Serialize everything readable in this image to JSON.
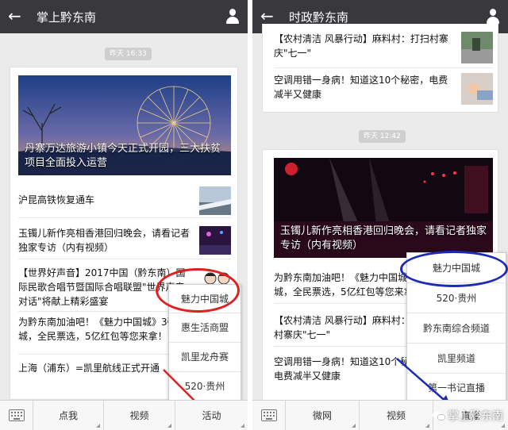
{
  "colors": {
    "topbar": "#39393d",
    "annotation_red": "#e02020",
    "annotation_blue": "#1c2bb5"
  },
  "left": {
    "title": "掌上黔东南",
    "back_icon": "←",
    "timestamp": "昨天 16:33",
    "hero_caption": "丹寨万达旅游小镇今天正式开园，三大扶贫项目全面投入运营",
    "rows": [
      {
        "text": "沪昆高铁恢复通车"
      },
      {
        "text": "玉镯儿新作亮相香港回归晚会，请看记者独家专访（内有视频）"
      },
      {
        "text": "【世界好声音】2017中国（黔东南）国际民歌合唱节暨国际合唱联盟\"世界声音对话\"将献上精彩盛宴"
      },
      {
        "text": "为黔东南加油吧！《魅力中国城》3强城，全民票选，5亿红包等您来拿！"
      },
      {
        "text": "上海（浦东）=凯里航线正式开通"
      }
    ],
    "popup_items": [
      "魅力中国城",
      "惠生活商盟",
      "凯里龙舟赛",
      "520·贵州"
    ],
    "menu": [
      "点我",
      "视频",
      "活动"
    ]
  },
  "right": {
    "title": "时政黔东南",
    "back_icon": "←",
    "rows_top": [
      {
        "text": "【农村清洁 风暴行动】麻料村：打扫村寨庆\"七一\""
      },
      {
        "text": "空调用错一身病！知道这10个秘密，电费减半又健康"
      }
    ],
    "timestamp": "昨天 12:42",
    "hero_caption": "玉镯儿新作亮相香港回归晚会，请看记者独家专访（内有视频）",
    "rows": [
      {
        "text": "为黔东南加油吧！《魅力中国城》3强城，全民票选，5亿红包等您来拿！"
      },
      {
        "text": "【农村清洁 风暴行动】麻料村：打扫村寨庆\"七一\""
      },
      {
        "text": "空调用错一身病！知道这10个秘密，电费减半又健康"
      }
    ],
    "popup_items": [
      "魅力中国城",
      "520·贵州",
      "黔东南综合频道",
      "凯里频道",
      "第一书记直播"
    ],
    "menu": [
      "微网",
      "视频",
      "直播"
    ],
    "watermark": "掌上黔东南"
  }
}
